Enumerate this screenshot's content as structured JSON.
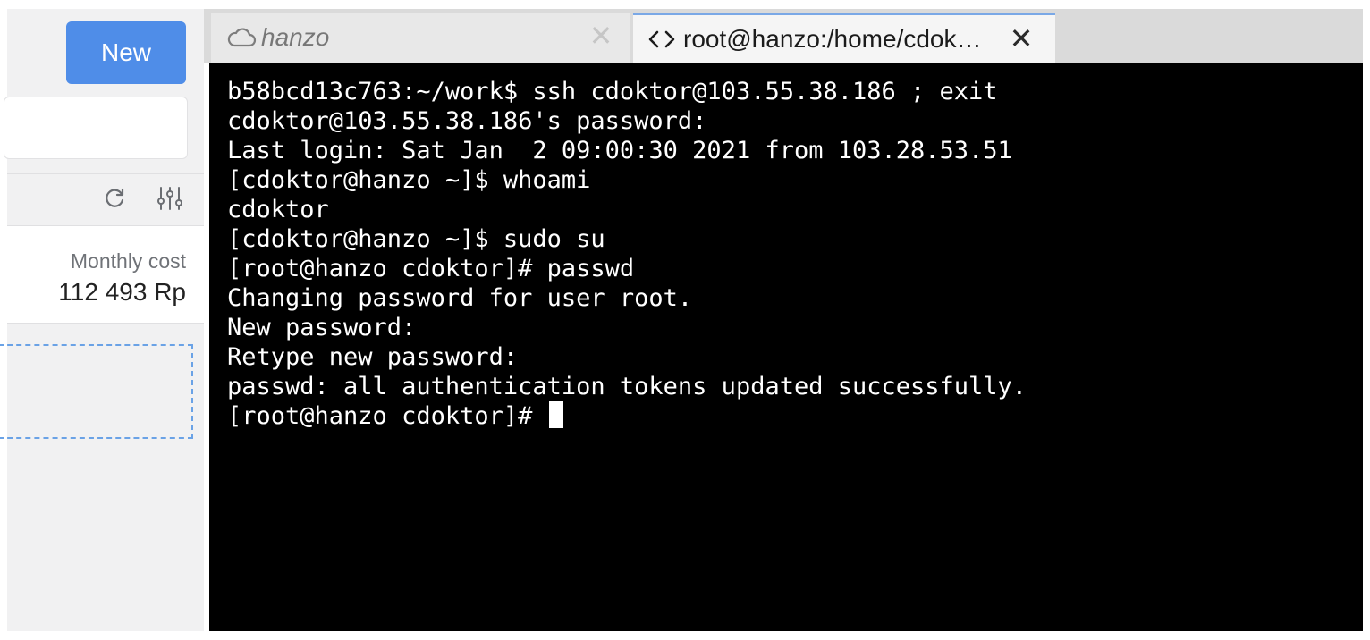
{
  "sidebar": {
    "new_button_label": "New",
    "search_value": "",
    "toolbar": {
      "refresh_icon": "refresh-icon",
      "filter_icon": "sliders-icon"
    },
    "cost": {
      "label": "Monthly cost",
      "value": "112 493 Rp"
    }
  },
  "tabs": [
    {
      "label": "hanzo",
      "icon": "cloud-icon",
      "active": false
    },
    {
      "label": "root@hanzo:/home/cdok…",
      "icon": "code-brackets-icon",
      "active": true
    }
  ],
  "terminal": {
    "lines": [
      "b58bcd13c763:~/work$ ssh cdoktor@103.55.38.186 ; exit",
      "cdoktor@103.55.38.186's password:",
      "Last login: Sat Jan  2 09:00:30 2021 from 103.28.53.51",
      "[cdoktor@hanzo ~]$ whoami",
      "cdoktor",
      "[cdoktor@hanzo ~]$ sudo su",
      "[root@hanzo cdoktor]# passwd",
      "Changing password for user root.",
      "New password:",
      "Retype new password:",
      "passwd: all authentication tokens updated successfully.",
      "[root@hanzo cdoktor]# "
    ]
  },
  "colors": {
    "accent": "#4f8de8",
    "terminal_bg": "#000000",
    "terminal_fg": "#ffffff",
    "dashed_border": "#6aa2e6"
  }
}
